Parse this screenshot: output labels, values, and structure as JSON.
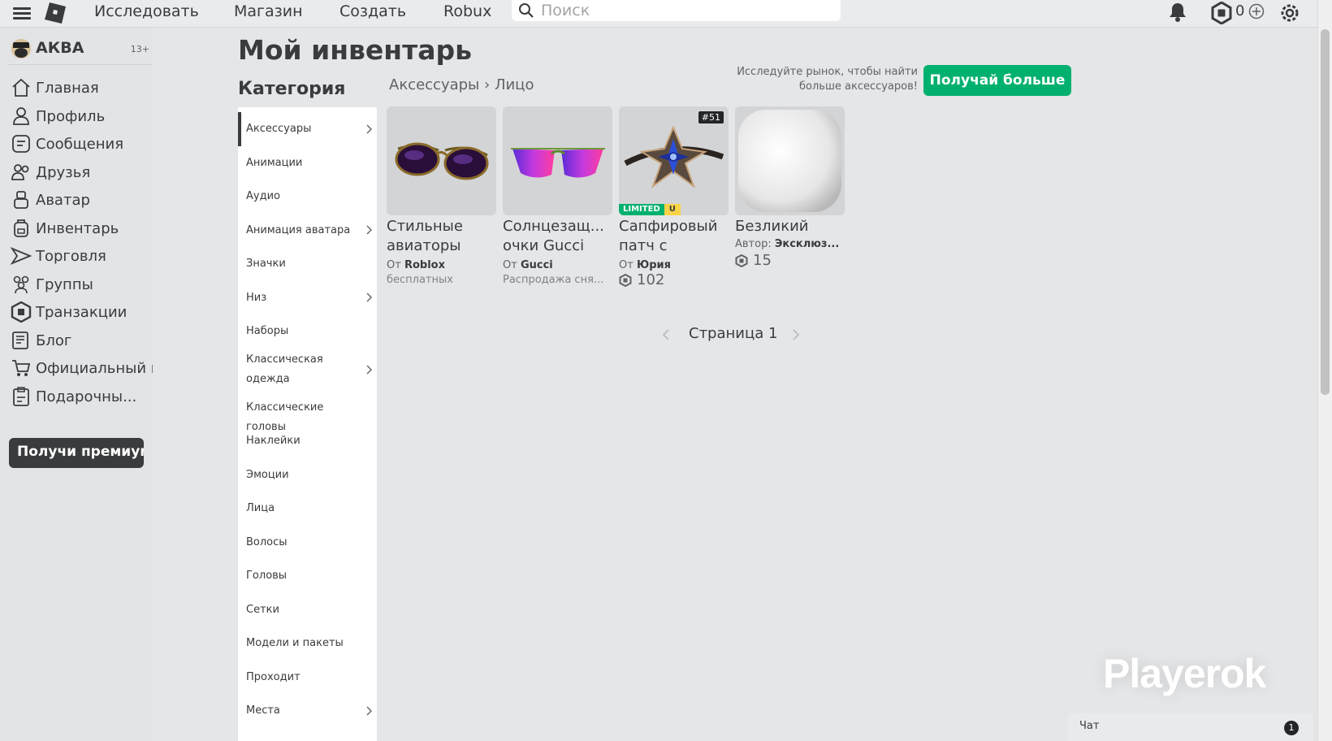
{
  "topbar": {
    "nav": [
      "Исследовать",
      "Магазин",
      "Создать",
      "Robux"
    ],
    "search_placeholder": "Поиск",
    "robux_balance": "0"
  },
  "sidebar": {
    "username": "АКВА",
    "age_badge": "13+",
    "items": [
      {
        "label": "Главная",
        "icon": "home-icon"
      },
      {
        "label": "Профиль",
        "icon": "profile-icon"
      },
      {
        "label": "Сообщения",
        "icon": "messages-icon"
      },
      {
        "label": "Друзья",
        "icon": "friends-icon"
      },
      {
        "label": "Аватар",
        "icon": "avatar-icon"
      },
      {
        "label": "Инвентарь",
        "icon": "inventory-icon"
      },
      {
        "label": "Торговля",
        "icon": "trade-icon"
      },
      {
        "label": "Группы",
        "icon": "groups-icon"
      },
      {
        "label": "Транзакции",
        "icon": "transactions-icon"
      },
      {
        "label": "Блог",
        "icon": "blog-icon"
      },
      {
        "label": "Официальный м",
        "icon": "store-icon"
      },
      {
        "label": "Подарочны...",
        "icon": "gift-card-icon"
      }
    ],
    "premium_button": "Получи премиум"
  },
  "main": {
    "title": "Мой инвентарь",
    "category_title": "Категория",
    "categories": [
      {
        "label": "Аксессуары",
        "chevron": true,
        "active": true
      },
      {
        "label": "Анимации",
        "chevron": false
      },
      {
        "label": "Аудио",
        "chevron": false
      },
      {
        "label": "Анимация аватара",
        "chevron": true
      },
      {
        "label": "Значки",
        "chevron": false
      },
      {
        "label": "Низ",
        "chevron": true
      },
      {
        "label": "Наборы",
        "chevron": false
      },
      {
        "label": "Классическая одежда",
        "chevron": true
      },
      {
        "label": "Классические головы",
        "chevron": false
      },
      {
        "label": "Наклейки",
        "chevron": false
      },
      {
        "label": "Эмоции",
        "chevron": false
      },
      {
        "label": "Лица",
        "chevron": false
      },
      {
        "label": "Волосы",
        "chevron": false
      },
      {
        "label": "Головы",
        "chevron": false
      },
      {
        "label": "Сетки",
        "chevron": false
      },
      {
        "label": "Модели и пакеты",
        "chevron": false
      },
      {
        "label": "Проходит",
        "chevron": false
      },
      {
        "label": "Места",
        "chevron": true
      }
    ],
    "breadcrumb": {
      "parent": "Аксессуары",
      "separator": "›",
      "current": "Лицо"
    },
    "market_prompt": "Исследуйте рынок, чтобы найти больше аксессуаров!",
    "get_more_button": "Получай больше",
    "items": [
      {
        "name_line1": "Стильные",
        "name_line2": "авиаторы",
        "creator_prefix": "От",
        "creator": "Roblox",
        "sub": "бесплатных"
      },
      {
        "name_line1": "Солнцезащ...",
        "name_line2": "очки Gucci",
        "creator_prefix": "От",
        "creator": "Gucci",
        "sub": "Распродажа сня..."
      },
      {
        "name_line1": "Сапфировый",
        "name_line2": "патч с",
        "creator_prefix": "От",
        "creator": "Юрия",
        "price": "102",
        "serial": "#51",
        "limited_label": "LIMITED",
        "limited_u": "U"
      },
      {
        "name_line1": "Безликий",
        "name_line2": "",
        "creator_prefix": "Автор:",
        "creator": "Эксклюз...",
        "price": "15"
      }
    ],
    "pager": {
      "label": "Страница 1"
    }
  },
  "watermark": "Playerok",
  "chat": {
    "label": "Чат",
    "unread": "1"
  },
  "colors": {
    "accent_green": "#00b06f",
    "limited_yellow": "#f8d348",
    "text": "#393b3d",
    "background": "#e5e6e8"
  }
}
